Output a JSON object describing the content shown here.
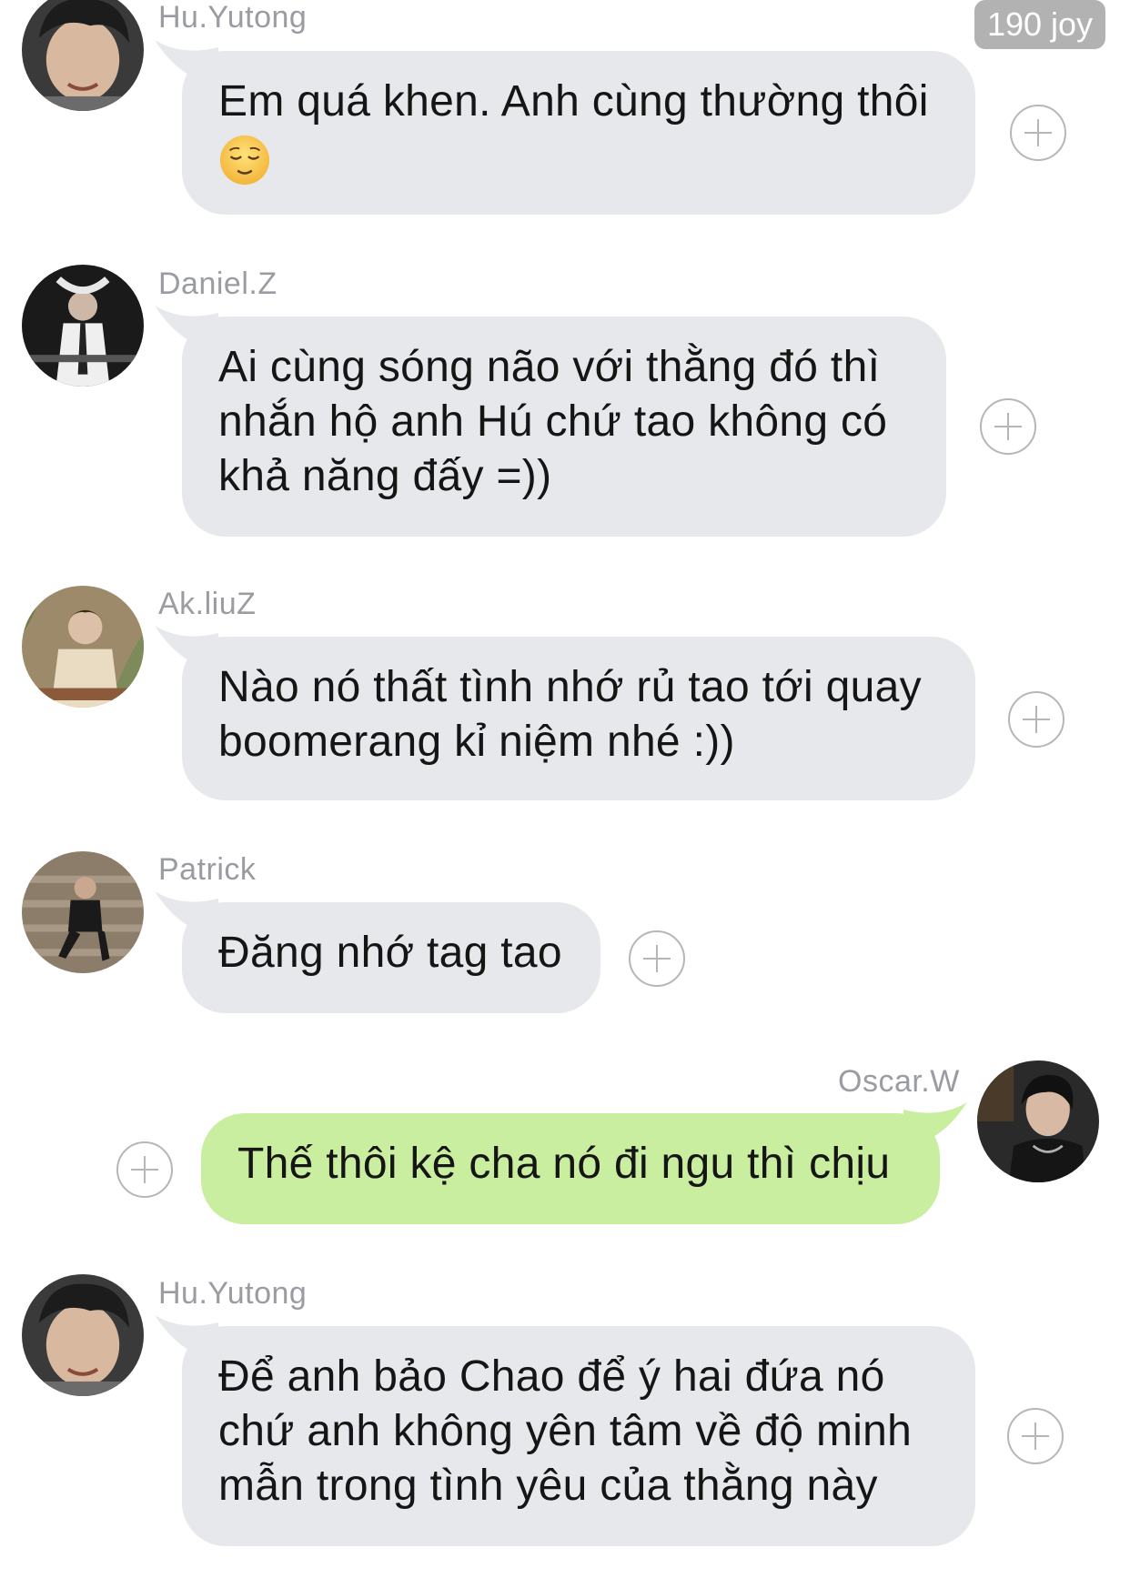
{
  "badge": {
    "joy_label": "190 joy"
  },
  "messages": [
    {
      "sender": "Hu.Yutong",
      "text_line1": "Em quá khen. Anh cùng thường thôi",
      "emoji": "relieved-face-icon"
    },
    {
      "sender": "Daniel.Z",
      "text": "Ai cùng sóng não với thằng đó thì nhắn hộ anh Hú chứ tao không có khả năng đấy =))"
    },
    {
      "sender": "Ak.liuZ",
      "text": "Nào nó thất tình nhớ rủ tao tới quay boomerang kỉ niệm nhé :))"
    },
    {
      "sender": "Patrick",
      "text": "Đăng nhớ tag tao"
    },
    {
      "sender": "Oscar.W",
      "text": "Thế thôi kệ cha nó đi ngu thì chịu"
    },
    {
      "sender": "Hu.Yutong",
      "text": "Để anh bảo Chao để ý hai đứa nó chứ anh không yên tâm về độ minh mẫn trong tình yêu của thằng này"
    }
  ],
  "colors": {
    "bubble_incoming": "#e6e8eb",
    "bubble_outgoing": "#c9eea0",
    "sender_name": "#9a9ca2",
    "badge_bg": "#b2b2b2"
  }
}
